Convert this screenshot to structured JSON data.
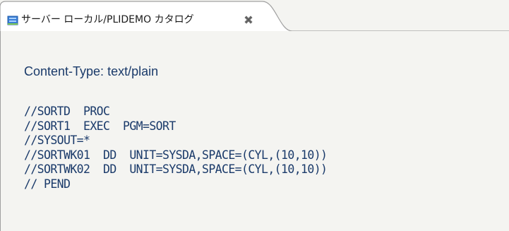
{
  "tab": {
    "title": "サーバー ローカル/PLIDEMO カタログ",
    "icon": "catalog-icon",
    "close_icon": "close-icon"
  },
  "content": {
    "content_type": "Content-Type: text/plain",
    "lines": [
      "//SORTD  PROC",
      "//SORT1  EXEC  PGM=SORT",
      "//SYSOUT=*",
      "//SORTWK01  DD  UNIT=SYSDA,SPACE=(CYL,(10,10))",
      "//SORTWK02  DD  UNIT=SYSDA,SPACE=(CYL,(10,10))",
      "// PEND"
    ]
  },
  "colors": {
    "text": "#1a3a6a",
    "background": "#f4f4f1",
    "tab_border": "#a0a0a0",
    "icon_blue": "#3a7fd5"
  }
}
